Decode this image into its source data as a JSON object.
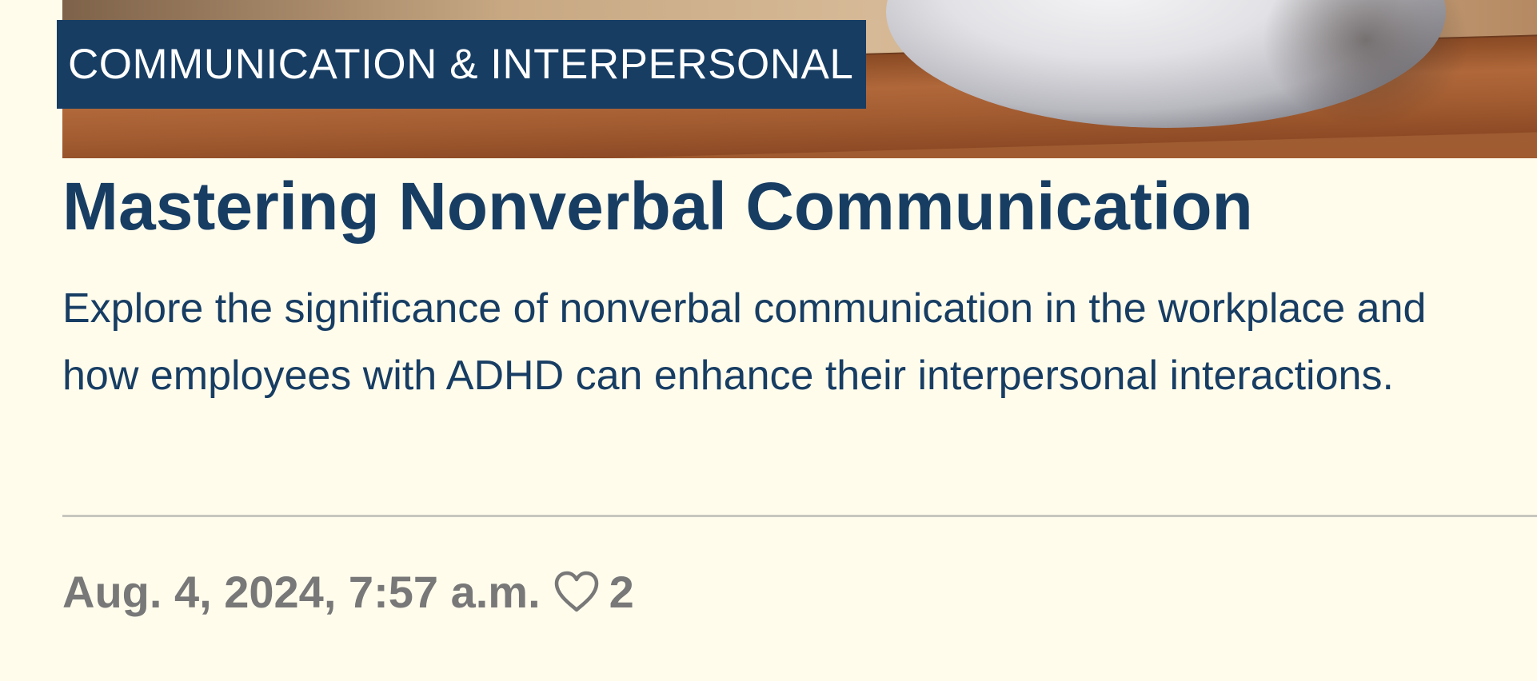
{
  "article": {
    "category": "COMMUNICATION & INTERPERSONAL",
    "title": "Mastering Nonverbal Communication",
    "excerpt": "Explore the significance of nonverbal communication in the workplace and how employees with ADHD can enhance their interpersonal interactions.",
    "published": "Aug. 4, 2024, 7:57 a.m.",
    "likes": "2"
  },
  "icons": {
    "like": "heart-outline-icon"
  },
  "colors": {
    "background": "#fffcec",
    "brand_navy": "#173d63",
    "meta_gray": "#787878",
    "divider": "#c7c7bf"
  }
}
